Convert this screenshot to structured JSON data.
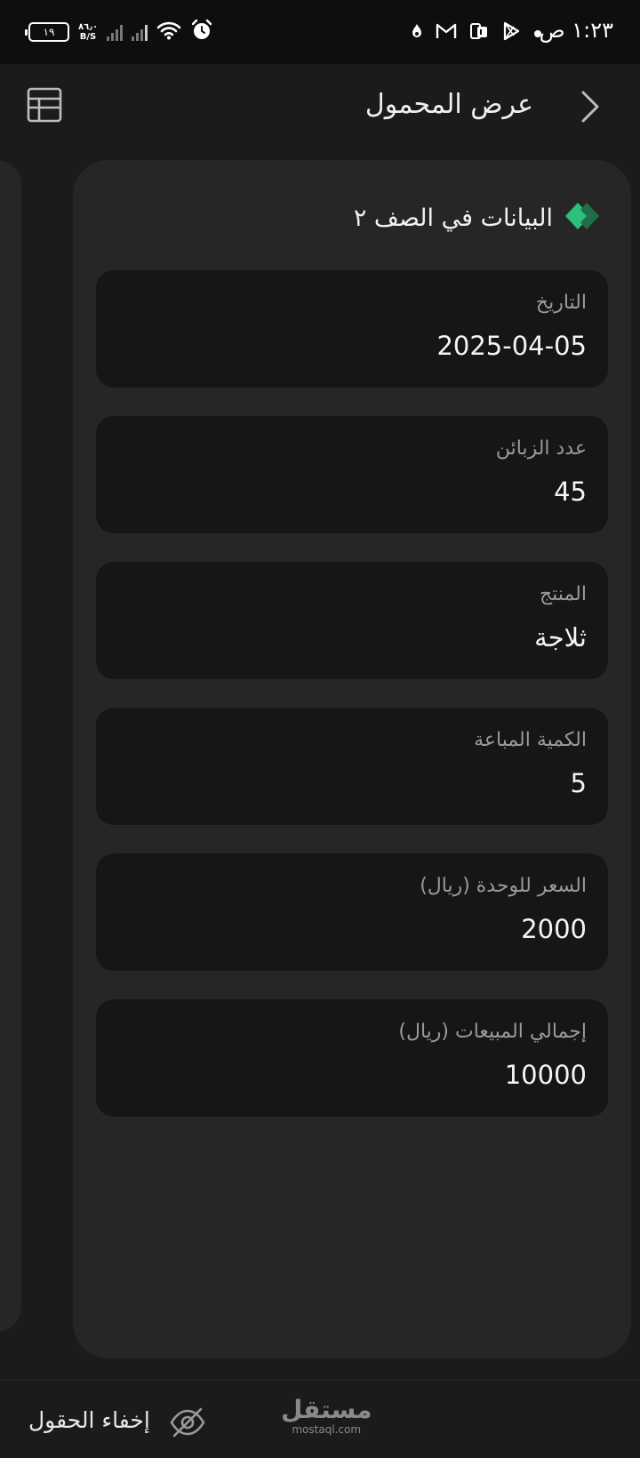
{
  "status_bar": {
    "time": "١:٢٣ ص",
    "battery_level": "١٩",
    "net_speed_value": "٨٦٫٠",
    "net_speed_unit": "B/S",
    "icons": [
      "dot-icon",
      "play-store-icon",
      "pdf-icon",
      "gmail-icon",
      "notification-icon",
      "alarm-icon",
      "wifi-icon",
      "signal-icon",
      "battery-icon"
    ]
  },
  "header": {
    "title": "عرض المحمول",
    "back_icon": "chevron-right-icon",
    "table_icon": "table-grid-icon"
  },
  "card": {
    "title": "البيانات في الصف ٢",
    "title_icon": "diamond-icon",
    "accent_color": "#2ebf7a",
    "fields": [
      {
        "label": "التاريخ",
        "value": "2025-04-05"
      },
      {
        "label": "عدد الزبائن",
        "value": "45"
      },
      {
        "label": "المنتج",
        "value": "ثلاجة"
      },
      {
        "label": "الكمية المباعة",
        "value": "5"
      },
      {
        "label": "السعر للوحدة (ريال)",
        "value": "2000"
      },
      {
        "label": "إجمالي المبيعات (ريال)",
        "value": "10000"
      }
    ]
  },
  "bottom_bar": {
    "hide_fields_label": "إخفاء الحقول",
    "hide_icon": "eye-off-icon",
    "watermark_main": "مستقل",
    "watermark_sub": "mostaql.com"
  }
}
